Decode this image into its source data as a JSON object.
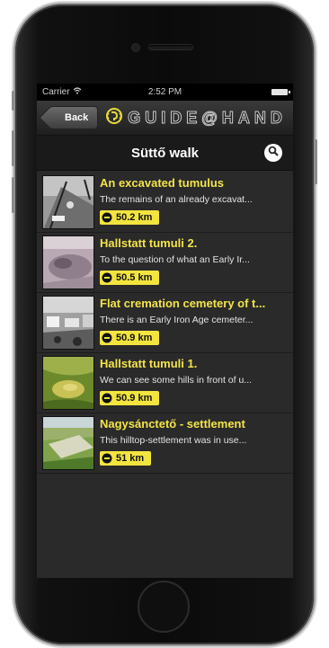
{
  "status_bar": {
    "carrier": "Carrier",
    "time": "2:52 PM"
  },
  "header": {
    "back_label": "Back",
    "logo_text": "GUIDE@HAND"
  },
  "title_bar": {
    "title": "Süttő walk"
  },
  "items": [
    {
      "title": "An excavated tumulus",
      "description": "The remains of an already excavat...",
      "distance": "50.2 km"
    },
    {
      "title": "Hallstatt tumuli 2.",
      "description": "To the question of what an Early Ir...",
      "distance": "50.5 km"
    },
    {
      "title": "Flat cremation cemetery of t...",
      "description": "There is an Early Iron Age cemeter...",
      "distance": "50.9 km"
    },
    {
      "title": "Hallstatt tumuli 1.",
      "description": "We can see some hills in front of u...",
      "distance": "50.9 km"
    },
    {
      "title": "Nagysánctető - settlement",
      "description": "This hilltop-settlement was in use...",
      "distance": "51 km"
    }
  ],
  "icons": {
    "wifi": "wifi-icon",
    "battery": "battery-icon",
    "logo": "ear-icon",
    "search": "search-icon",
    "distance": "minus-circle-icon"
  },
  "colors": {
    "accent_yellow": "#f4e44a",
    "background": "#2a2a2a"
  }
}
